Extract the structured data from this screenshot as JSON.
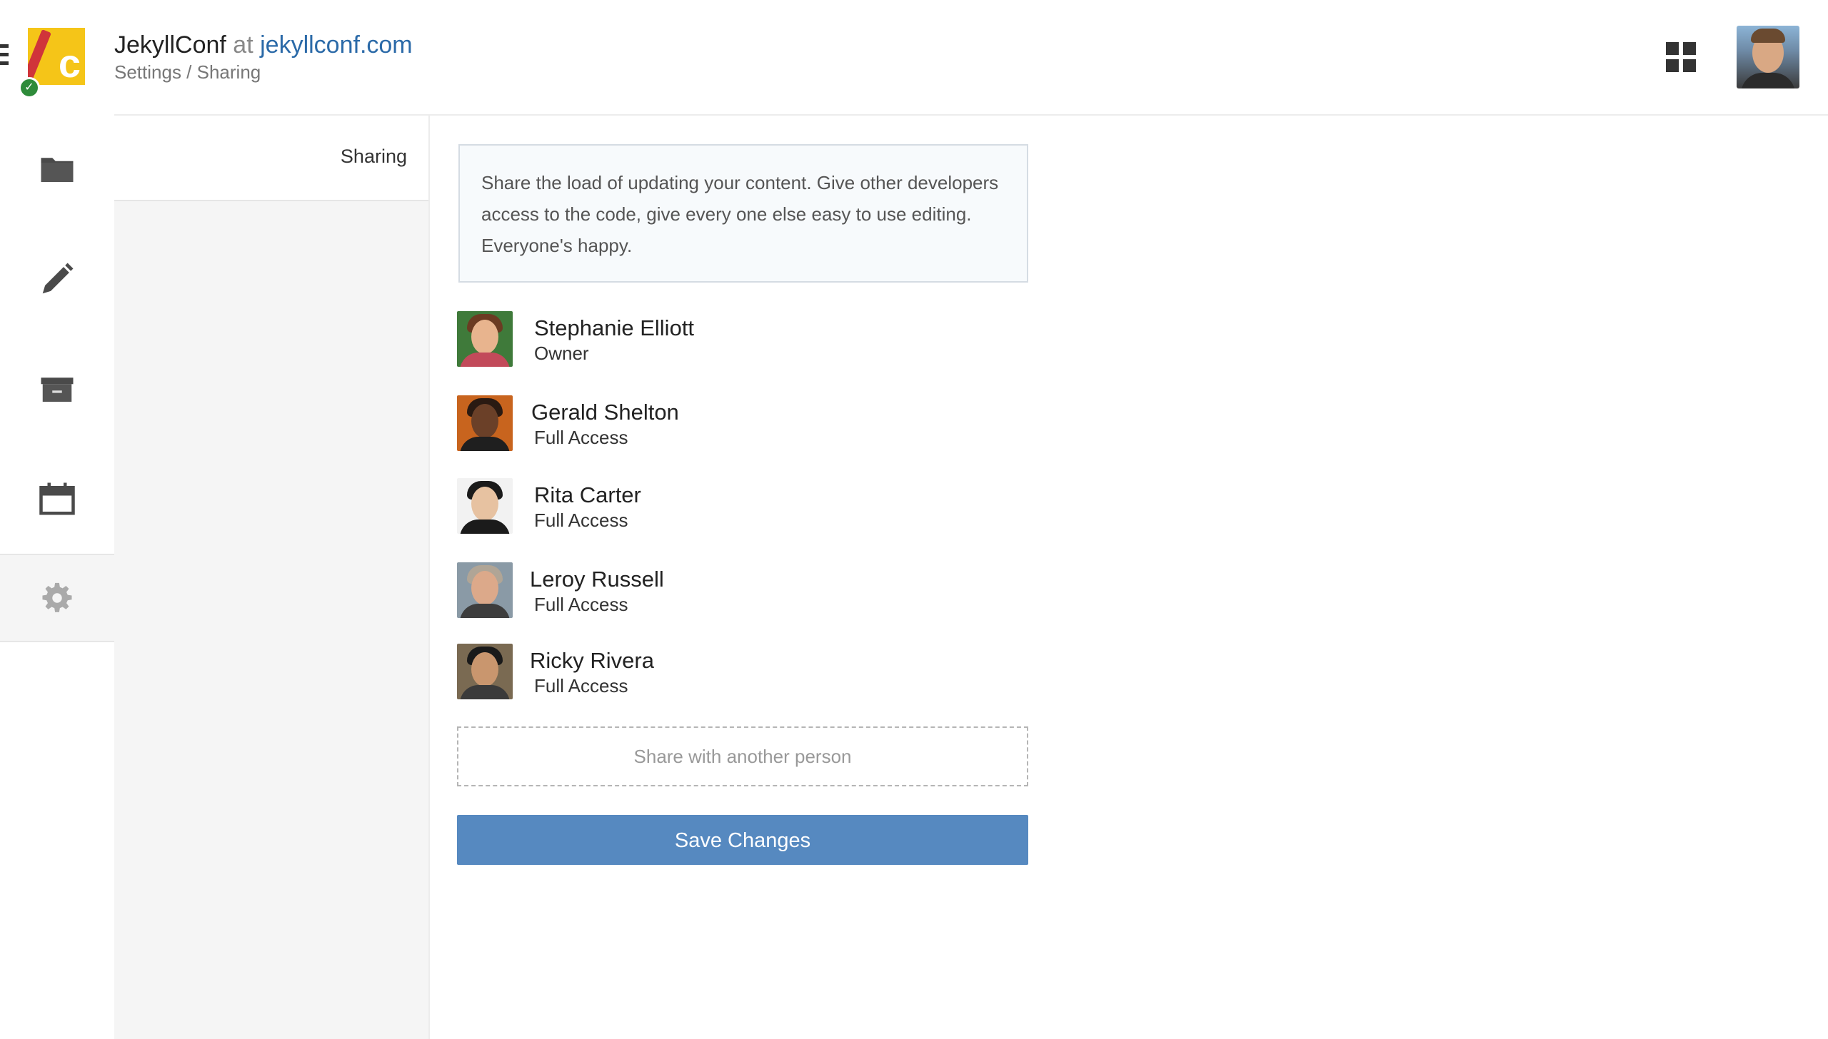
{
  "header": {
    "site_name": "JekyllConf",
    "at_text": "at",
    "domain": "jekyllconf.com",
    "breadcrumb": "Settings / Sharing",
    "logo_letter": "c"
  },
  "nav": {
    "items": [
      {
        "icon": "folder-icon"
      },
      {
        "icon": "pencil-icon"
      },
      {
        "icon": "archive-icon"
      },
      {
        "icon": "calendar-icon"
      },
      {
        "icon": "gear-icon",
        "active": true
      }
    ]
  },
  "subnav": {
    "items": [
      {
        "label": "Sharing"
      }
    ]
  },
  "main": {
    "info_text": "Share the load of updating your content. Give other developers access to the code, give every one else easy to use editing. Everyone's happy.",
    "people": [
      {
        "name": "Stephanie Elliott",
        "role": "Owner"
      },
      {
        "name": "Gerald Shelton",
        "role": "Full Access"
      },
      {
        "name": "Rita Carter",
        "role": "Full Access"
      },
      {
        "name": "Leroy Russell",
        "role": "Full Access"
      },
      {
        "name": "Ricky Rivera",
        "role": "Full Access"
      }
    ],
    "share_placeholder": "Share with another person",
    "save_label": "Save Changes"
  },
  "colors": {
    "accent": "#5689c0",
    "link": "#2b6aa8",
    "logo_bg": "#f5c518",
    "info_border": "#d5dce3"
  }
}
